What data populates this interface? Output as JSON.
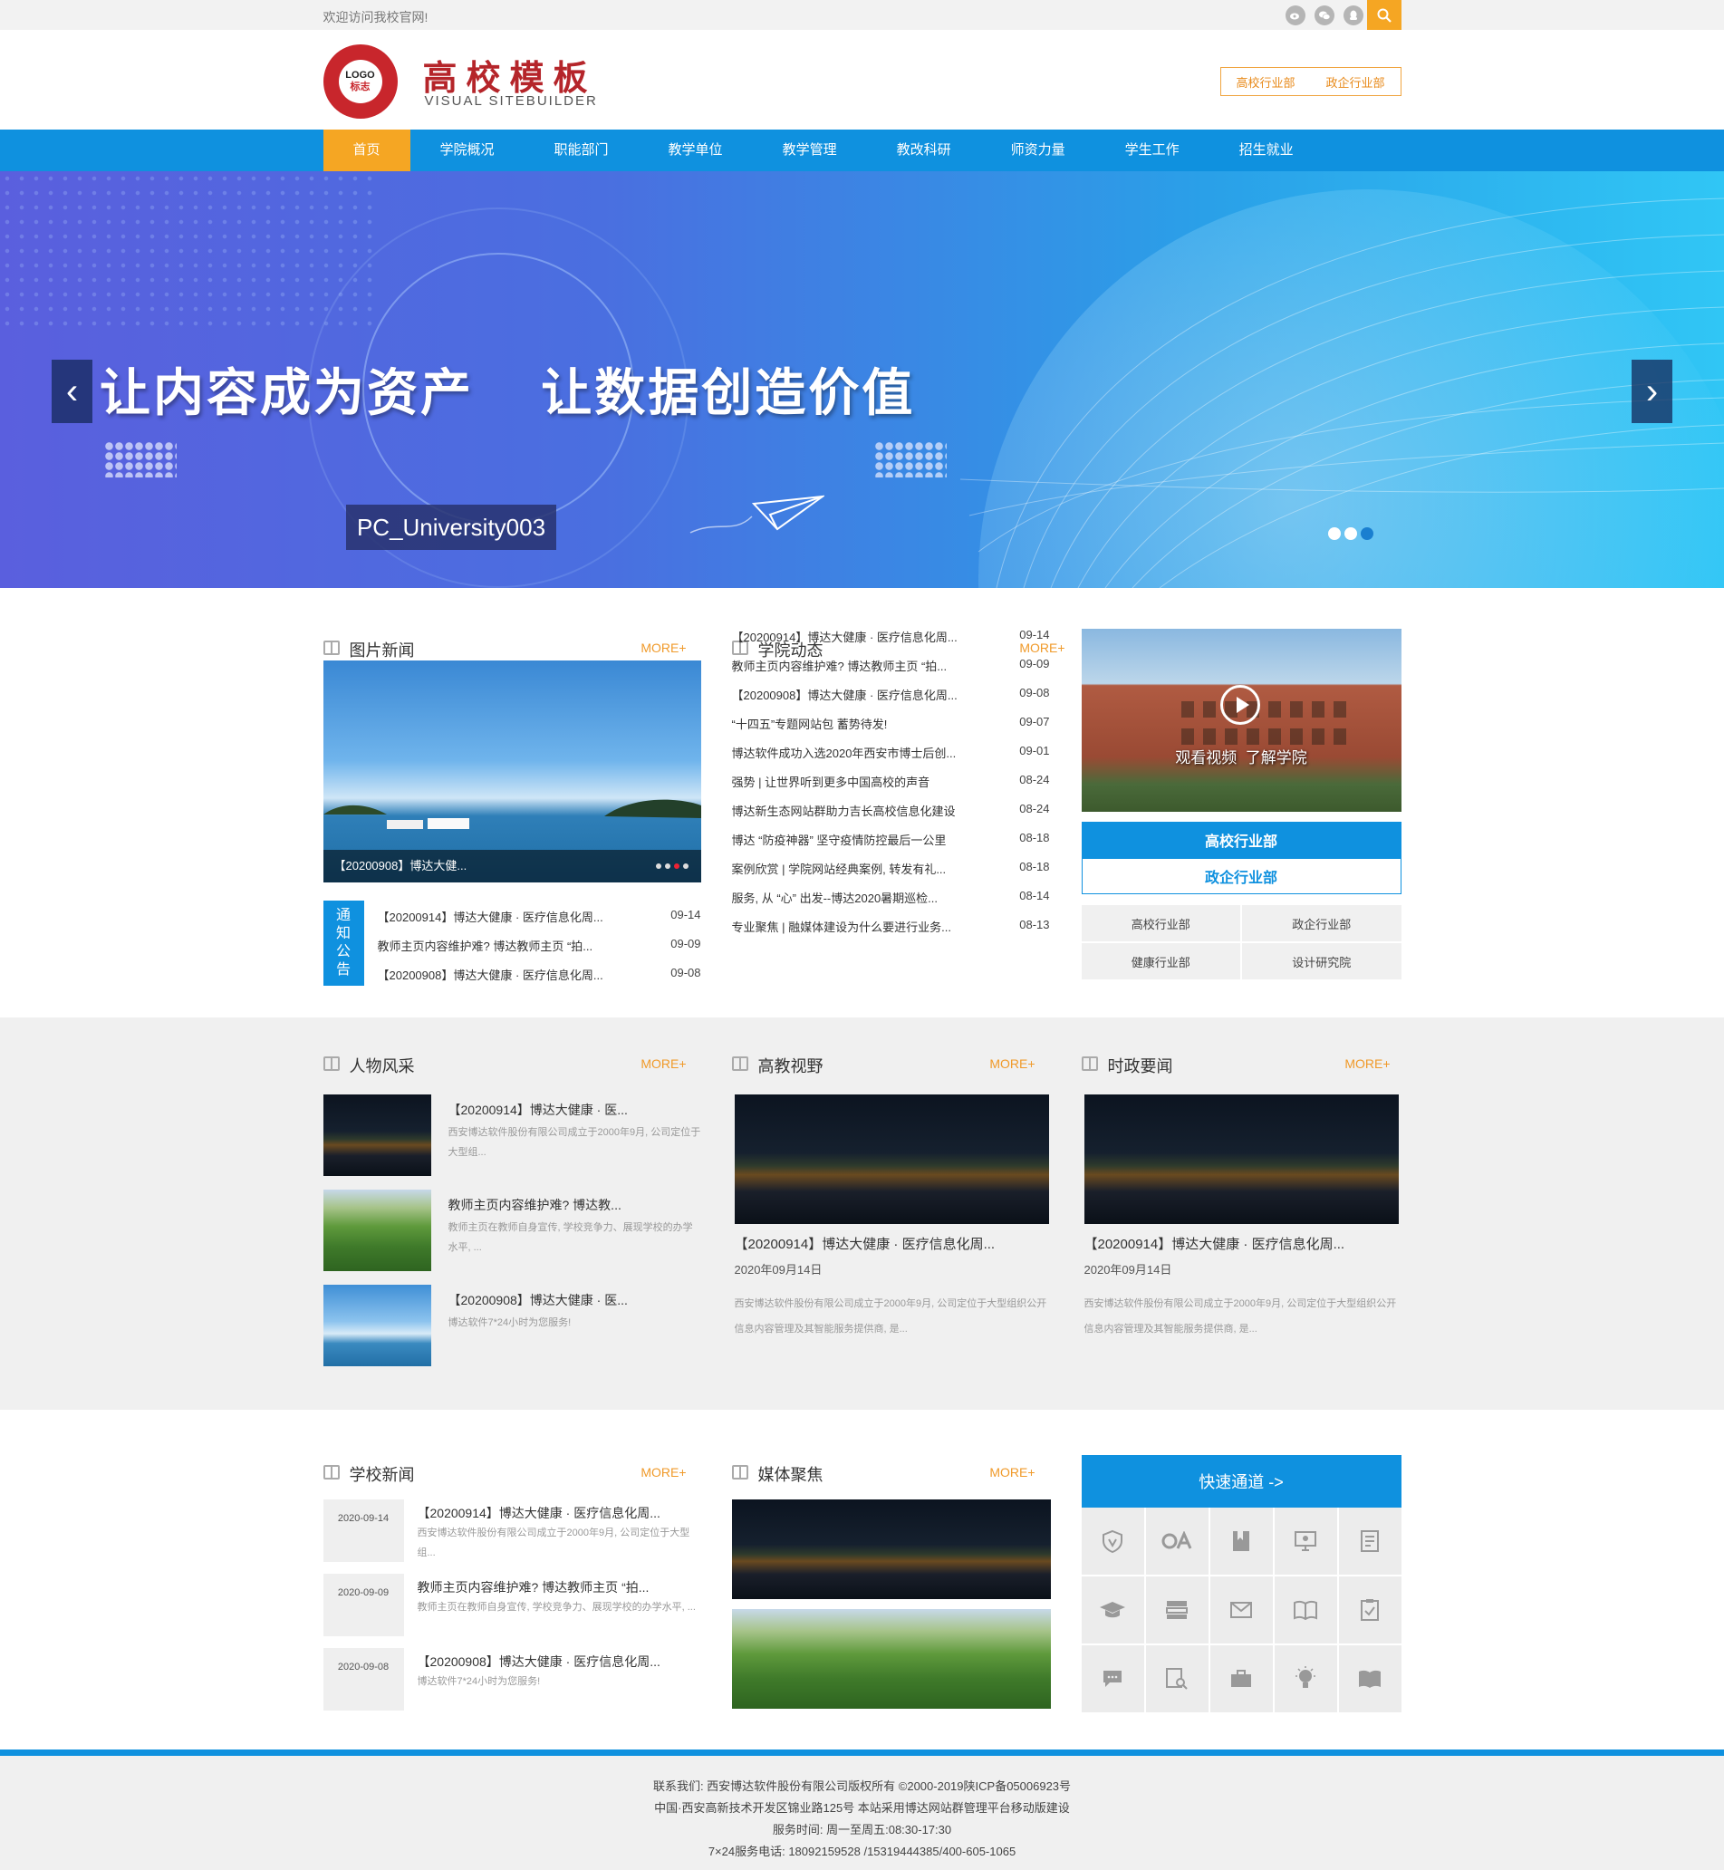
{
  "topbar": {
    "welcome": "欢迎访问我校官网!",
    "social": [
      "weibo-icon",
      "wechat-icon",
      "qq-icon"
    ],
    "search_icon": "search-icon"
  },
  "header": {
    "logo_text": "LOGO",
    "logo_sub_cn": "标志",
    "title": "高校模板",
    "subtitle": "VISUAL  SITEBUILDER",
    "links": [
      "高校行业部",
      "政企行业部"
    ]
  },
  "nav": {
    "items": [
      "首页",
      "学院概况",
      "职能部门",
      "教学单位",
      "教学管理",
      "教改科研",
      "师资力量",
      "学生工作",
      "招生就业"
    ],
    "active": 0
  },
  "banner": {
    "slogan": "让内容成为资产    让数据创造价值",
    "tag": "PC_University003",
    "prev": "‹",
    "next": "›"
  },
  "photo_news": {
    "title": "图片新闻",
    "more": "MORE+",
    "caption": "【20200908】博达大健..."
  },
  "notice": {
    "label": "通知公告",
    "items": [
      {
        "text": "【20200914】博达大健康 · 医疗信息化周...",
        "date": "09-14"
      },
      {
        "text": "教师主页内容维护难? 博达教师主页 “拍...",
        "date": "09-09"
      },
      {
        "text": "【20200908】博达大健康 · 医疗信息化周...",
        "date": "09-08"
      }
    ]
  },
  "college_news": {
    "title": "学院动态",
    "more": "MORE+",
    "items": [
      {
        "text": "【20200914】博达大健康 · 医疗信息化周...",
        "date": "09-14"
      },
      {
        "text": "教师主页内容维护难? 博达教师主页 “拍...",
        "date": "09-09"
      },
      {
        "text": "【20200908】博达大健康 · 医疗信息化周...",
        "date": "09-08"
      },
      {
        "text": "“十四五”专题网站包 蓄势待发!",
        "date": "09-07"
      },
      {
        "text": "博达软件成功入选2020年西安市博士后创...",
        "date": "09-01"
      },
      {
        "text": "强势 | 让世界听到更多中国高校的声音",
        "date": "08-24"
      },
      {
        "text": "博达新生态网站群助力吉长高校信息化建设",
        "date": "08-24"
      },
      {
        "text": "博达 “防疫神器” 坚守疫情防控最后一公里",
        "date": "08-18"
      },
      {
        "text": "案例欣赏 | 学院网站经典案例, 转发有礼...",
        "date": "08-18"
      },
      {
        "text": "服务, 从 “心” 出发--博达2020暑期巡检...",
        "date": "08-14"
      },
      {
        "text": "专业聚焦 | 融媒体建设为什么要进行业务...",
        "date": "08-13"
      }
    ]
  },
  "video": {
    "text": "观看视频  了解学院",
    "btn1": "高校行业部",
    "btn2": "政企行业部",
    "grid": [
      "高校行业部",
      "政企行业部",
      "健康行业部",
      "设计研究院"
    ]
  },
  "people": {
    "title": "人物风采",
    "more": "MORE+",
    "items": [
      {
        "title": "【20200914】博达大健康 · 医...",
        "desc": "西安博达软件股份有限公司成立于2000年9月, 公司定位于大型组..."
      },
      {
        "title": "教师主页内容维护难? 博达教...",
        "desc": "教师主页在教师自身宣传, 学校竞争力、展现学校的办学水平, ..."
      },
      {
        "title": "【20200908】博达大健康 · 医...",
        "desc": "博达软件7*24小时为您服务!"
      }
    ]
  },
  "higher_ed": {
    "title": "高教视野",
    "more": "MORE+",
    "item_title": "【20200914】博达大健康 · 医疗信息化周...",
    "date": "2020年09月14日",
    "desc": "西安博达软件股份有限公司成立于2000年9月, 公司定位于大型组织公开信息内容管理及其智能服务提供商, 是..."
  },
  "politics": {
    "title": "时政要闻",
    "more": "MORE+",
    "item_title": "【20200914】博达大健康 · 医疗信息化周...",
    "date": "2020年09月14日",
    "desc": "西安博达软件股份有限公司成立于2000年9月, 公司定位于大型组织公开信息内容管理及其智能服务提供商, 是..."
  },
  "school_news": {
    "title": "学校新闻",
    "more": "MORE+",
    "items": [
      {
        "date": "2020-09-14",
        "title": "【20200914】博达大健康 · 医疗信息化周...",
        "desc": "西安博达软件股份有限公司成立于2000年9月, 公司定位于大型组..."
      },
      {
        "date": "2020-09-09",
        "title": "教师主页内容维护难? 博达教师主页 “拍...",
        "desc": "教师主页在教师自身宣传, 学校竞争力、展现学校的办学水平, ..."
      },
      {
        "date": "2020-09-08",
        "title": "【20200908】博达大健康 · 医疗信息化周...",
        "desc": "博达软件7*24小时为您服务!"
      }
    ]
  },
  "media": {
    "title": "媒体聚焦",
    "more": "MORE+"
  },
  "quick": {
    "title": "快速通道 ->",
    "icons": [
      "shield-icon",
      "oa-icon",
      "bookmark-icon",
      "monitor-icon",
      "document-icon",
      "graduation-cap-icon",
      "server-icon",
      "mail-icon",
      "book-icon",
      "clipboard-check-icon",
      "chat-icon",
      "search-doc-icon",
      "briefcase-icon",
      "lightbulb-icon",
      "open-book-icon"
    ]
  },
  "footer": {
    "lines": [
      "联系我们: 西安博达软件股份有限公司版权所有 ©2000-2019陕ICP备05006923号",
      "中国·西安高新技术开发区锦业路125号 本站采用博达网站群管理平台移动版建设",
      "服务时间: 周一至周五:08:30-17:30",
      "7×24服务电话: 18092159528 /15319444385/400-605-1065"
    ]
  },
  "colors": {
    "primary": "#0f91df",
    "accent": "#f5a623",
    "more": "#f09a2a",
    "logo_red": "#c8262c"
  }
}
